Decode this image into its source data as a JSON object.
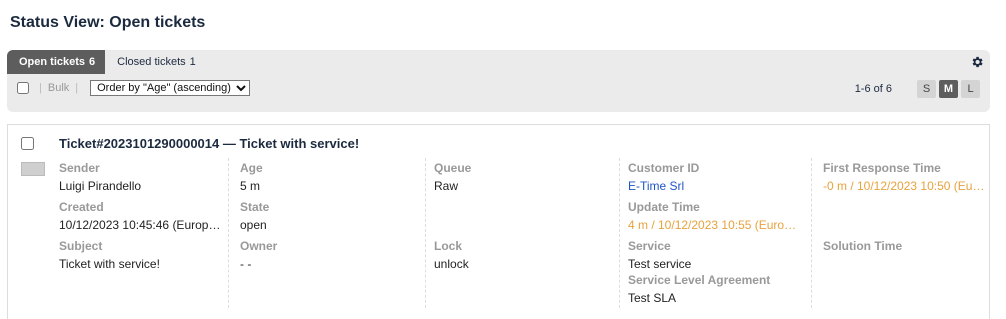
{
  "page": {
    "title": "Status View: Open tickets"
  },
  "tabs": [
    {
      "label": "Open tickets",
      "count": "6"
    },
    {
      "label": "Closed tickets",
      "count": "1"
    }
  ],
  "toolbar": {
    "separator": "|",
    "bulk_label": "Bulk",
    "order_by_value": "Order by \"Age\" (ascending)"
  },
  "paging": {
    "text": "1-6 of 6"
  },
  "view_sizes": [
    "S",
    "M",
    "L"
  ],
  "ticket": {
    "title": "Ticket#2023101290000014 — Ticket with service!",
    "sender_label": "Sender",
    "sender": "Luigi Pirandello",
    "created_label": "Created",
    "created": "10/12/2023 10:45:46 (Europe…",
    "subject_label": "Subject",
    "subject": "Ticket with service!",
    "age_label": "Age",
    "age": "5 m",
    "state_label": "State",
    "state": "open",
    "owner_label": "Owner",
    "owner": "- -",
    "queue_label": "Queue",
    "queue": "Raw",
    "lock_label": "Lock",
    "lock": "unlock",
    "customer_id_label": "Customer ID",
    "customer_id": "E-Time Srl",
    "update_time_label": "Update Time",
    "update_time": "4 m / 10/12/2023 10:55 (Euro…",
    "service_label": "Service",
    "service": "Test service",
    "sla_label": "Service Level Agreement",
    "sla": "Test SLA",
    "first_response_label": "First Response Time",
    "first_response": "-0 m / 10/12/2023 10:50 (Euro…",
    "solution_time_label": "Solution Time"
  },
  "colors": {
    "accent": "#1f56c7",
    "warning": "#e8a23c",
    "tab_active": "#5d5d5d"
  }
}
